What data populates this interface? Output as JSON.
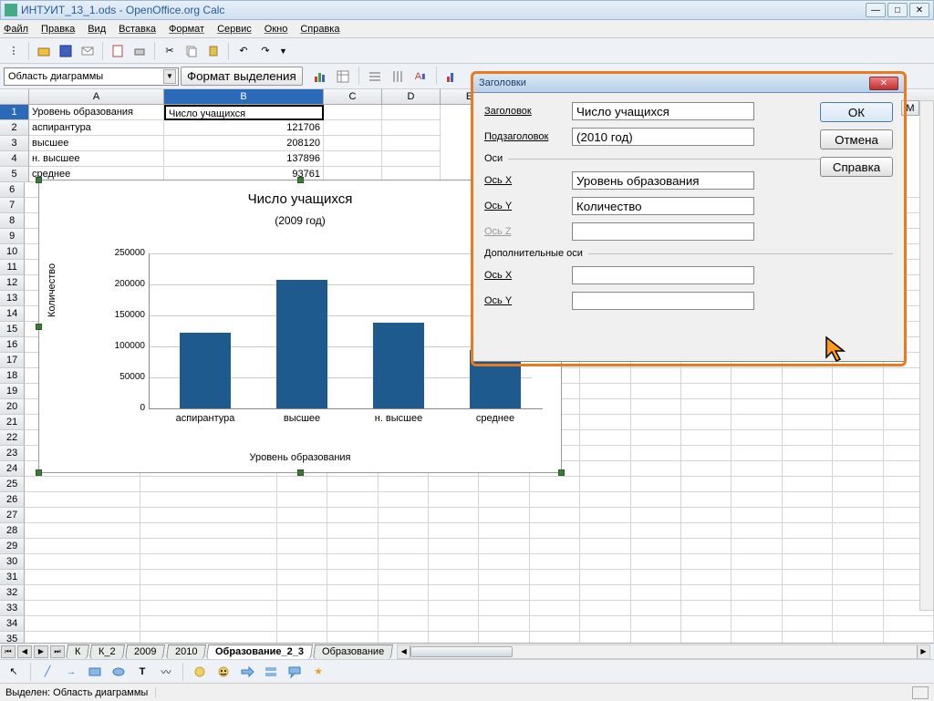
{
  "window": {
    "title": "ИНТУИТ_13_1.ods - OpenOffice.org Calc"
  },
  "menu": {
    "file": "Файл",
    "edit": "Правка",
    "view": "Вид",
    "insert": "Вставка",
    "format": "Формат",
    "service": "Сервис",
    "window": "Окно",
    "help": "Справка"
  },
  "namebox": "Область диаграммы",
  "format_selection": "Формат выделения",
  "columns": {
    "A": "A",
    "B": "B",
    "C": "C",
    "D": "D",
    "E": "E",
    "M": "M"
  },
  "table": {
    "header": {
      "A": "Уровень образования",
      "B": "Число учащихся"
    },
    "rows": [
      {
        "A": "аспирантура",
        "B": "121706"
      },
      {
        "A": "высшее",
        "B": "208120"
      },
      {
        "A": "н. высшее",
        "B": "137896"
      },
      {
        "A": "среднее",
        "B": "93761"
      }
    ]
  },
  "chart_display": {
    "title": "Число учащихся",
    "subtitle": "(2009 год)",
    "ylabel": "Количество",
    "xlabel": "Уровень образования",
    "yticks": [
      "0",
      "50000",
      "100000",
      "150000",
      "200000",
      "250000"
    ],
    "xticks": [
      "аспирантура",
      "высшее",
      "н. высшее",
      "среднее"
    ]
  },
  "chart_data": {
    "type": "bar",
    "title": "Число учащихся",
    "subtitle": "(2009 год)",
    "xlabel": "Уровень образования",
    "ylabel": "Количество",
    "ylim": [
      0,
      250000
    ],
    "categories": [
      "аспирантура",
      "высшее",
      "н. высшее",
      "среднее"
    ],
    "values": [
      121706,
      208120,
      137896,
      93761
    ]
  },
  "dialog": {
    "title": "Заголовки",
    "lbl_title": "Заголовок",
    "val_title": "Число учащихся",
    "lbl_sub": "Подзаголовок",
    "val_sub": "(2010 год)",
    "group_axes": "Оси",
    "lbl_x": "Ось X",
    "val_x": "Уровень образования",
    "lbl_y": "Ось Y",
    "val_y": "Количество",
    "lbl_z": "Ось Z",
    "val_z": "",
    "group_extra": "Дополнительные оси",
    "lbl_x2": "Ось X",
    "val_x2": "",
    "lbl_y2": "Ось Y",
    "val_y2": "",
    "btn_ok": "ОК",
    "btn_cancel": "Отмена",
    "btn_help": "Справка"
  },
  "tabs": {
    "t1": "К",
    "t2": "К_2",
    "t3": "2009",
    "t4": "2010",
    "t5": "Образование_2_3",
    "t6": "Образование"
  },
  "status": {
    "text": "Выделен: Область диаграммы"
  }
}
